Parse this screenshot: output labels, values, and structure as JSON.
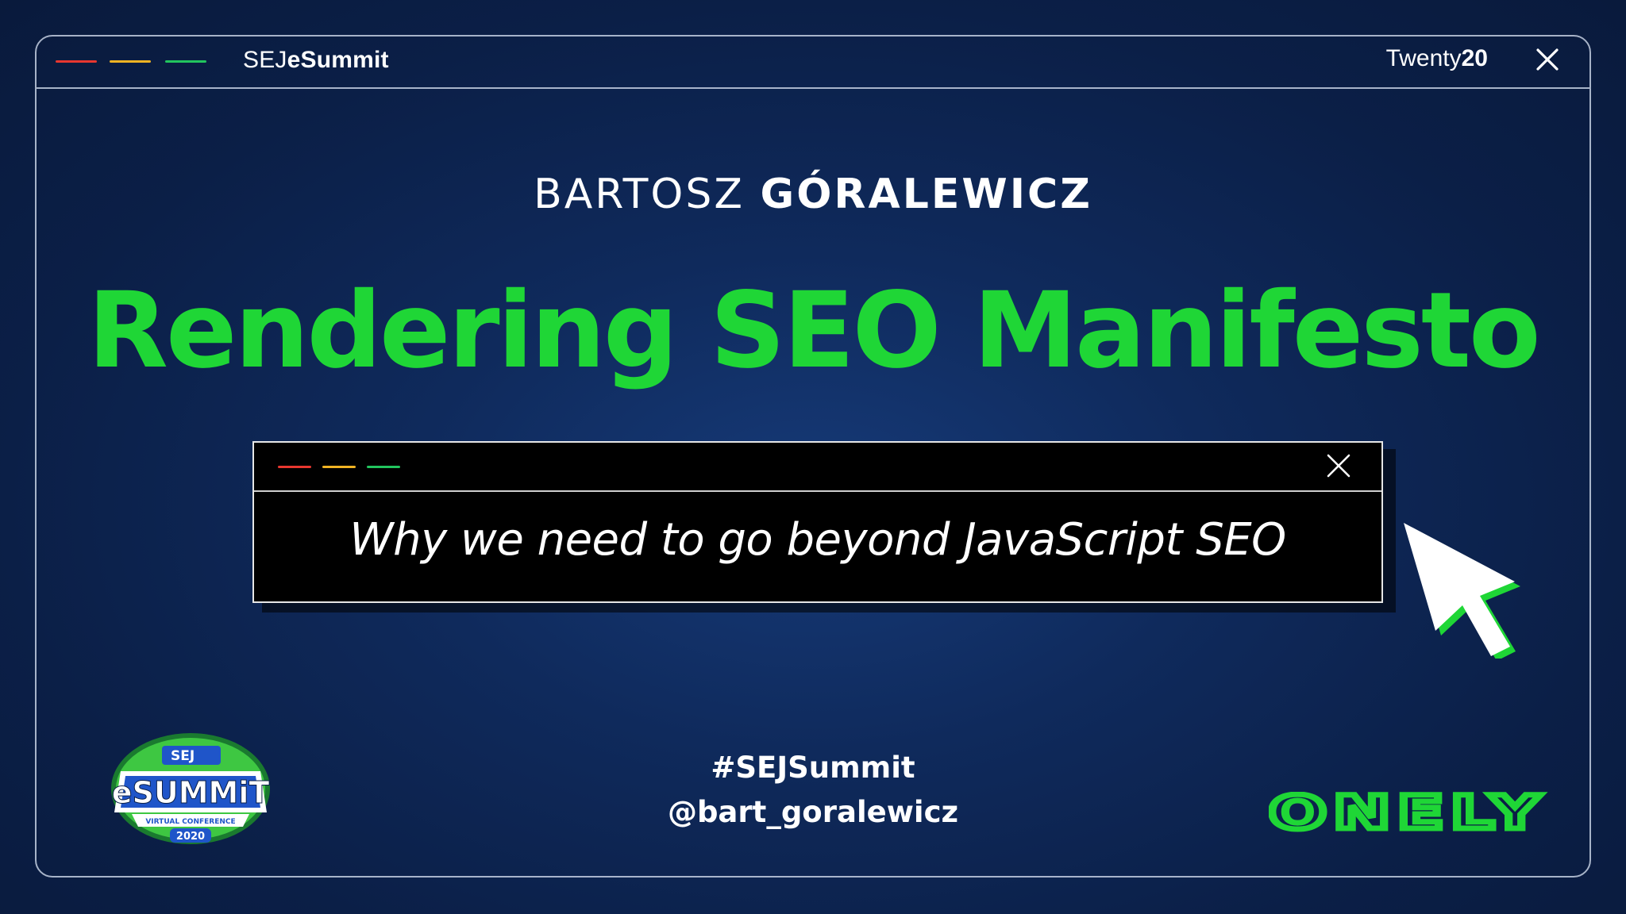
{
  "window": {
    "brand_prefix": "SEJ",
    "brand_suffix": "eSummit",
    "edition_prefix": "Twenty",
    "edition_suffix": "20",
    "dash_colors": [
      "#e8372f",
      "#f0b323",
      "#22c55e"
    ]
  },
  "slide": {
    "speaker_first": "BARTOSZ",
    "speaker_last": "GÓRALEWICZ",
    "title": "Rendering SEO Manifesto",
    "subtitle": "Why we need to go beyond JavaScript SEO",
    "hashtag": "#SEJSummit",
    "handle": "@bart_goralewicz"
  },
  "logos": {
    "esummit": {
      "badge": "SEJ",
      "word": "eSUMMiT",
      "ribbon": "VIRTUAL CONFERENCE",
      "year": "2020"
    },
    "onely": "ONELY"
  },
  "colors": {
    "accent_green": "#1fd636",
    "background": "#0f2a5c",
    "frame": "#dce6f5"
  },
  "icons": {
    "outer_close": "close-icon",
    "inner_close": "close-icon",
    "pointer": "cursor-arrow-icon"
  }
}
